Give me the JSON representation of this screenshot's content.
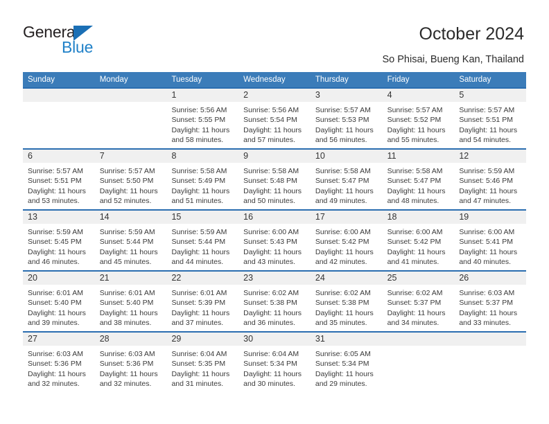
{
  "brand": {
    "name_part1": "General",
    "name_part2": "Blue",
    "triangle_color": "#1a6fb5",
    "blue_color": "#2081c8",
    "dark_color": "#231f20"
  },
  "header": {
    "title": "October 2024",
    "subtitle": "So Phisai, Bueng Kan, Thailand"
  },
  "theme": {
    "header_bg": "#3b7cb9",
    "row_border": "#2a6db0",
    "day_strip_bg": "#f0f0f0",
    "text_color": "#3a3a3a"
  },
  "calendar": {
    "weekdays": [
      "Sunday",
      "Monday",
      "Tuesday",
      "Wednesday",
      "Thursday",
      "Friday",
      "Saturday"
    ],
    "weeks": [
      [
        {
          "day": "",
          "lines": [],
          "empty": true
        },
        {
          "day": "",
          "lines": [],
          "empty": true
        },
        {
          "day": "1",
          "lines": [
            "Sunrise: 5:56 AM",
            "Sunset: 5:55 PM",
            "Daylight: 11 hours",
            "and 58 minutes."
          ]
        },
        {
          "day": "2",
          "lines": [
            "Sunrise: 5:56 AM",
            "Sunset: 5:54 PM",
            "Daylight: 11 hours",
            "and 57 minutes."
          ]
        },
        {
          "day": "3",
          "lines": [
            "Sunrise: 5:57 AM",
            "Sunset: 5:53 PM",
            "Daylight: 11 hours",
            "and 56 minutes."
          ]
        },
        {
          "day": "4",
          "lines": [
            "Sunrise: 5:57 AM",
            "Sunset: 5:52 PM",
            "Daylight: 11 hours",
            "and 55 minutes."
          ]
        },
        {
          "day": "5",
          "lines": [
            "Sunrise: 5:57 AM",
            "Sunset: 5:51 PM",
            "Daylight: 11 hours",
            "and 54 minutes."
          ]
        }
      ],
      [
        {
          "day": "6",
          "lines": [
            "Sunrise: 5:57 AM",
            "Sunset: 5:51 PM",
            "Daylight: 11 hours",
            "and 53 minutes."
          ]
        },
        {
          "day": "7",
          "lines": [
            "Sunrise: 5:57 AM",
            "Sunset: 5:50 PM",
            "Daylight: 11 hours",
            "and 52 minutes."
          ]
        },
        {
          "day": "8",
          "lines": [
            "Sunrise: 5:58 AM",
            "Sunset: 5:49 PM",
            "Daylight: 11 hours",
            "and 51 minutes."
          ]
        },
        {
          "day": "9",
          "lines": [
            "Sunrise: 5:58 AM",
            "Sunset: 5:48 PM",
            "Daylight: 11 hours",
            "and 50 minutes."
          ]
        },
        {
          "day": "10",
          "lines": [
            "Sunrise: 5:58 AM",
            "Sunset: 5:47 PM",
            "Daylight: 11 hours",
            "and 49 minutes."
          ]
        },
        {
          "day": "11",
          "lines": [
            "Sunrise: 5:58 AM",
            "Sunset: 5:47 PM",
            "Daylight: 11 hours",
            "and 48 minutes."
          ]
        },
        {
          "day": "12",
          "lines": [
            "Sunrise: 5:59 AM",
            "Sunset: 5:46 PM",
            "Daylight: 11 hours",
            "and 47 minutes."
          ]
        }
      ],
      [
        {
          "day": "13",
          "lines": [
            "Sunrise: 5:59 AM",
            "Sunset: 5:45 PM",
            "Daylight: 11 hours",
            "and 46 minutes."
          ]
        },
        {
          "day": "14",
          "lines": [
            "Sunrise: 5:59 AM",
            "Sunset: 5:44 PM",
            "Daylight: 11 hours",
            "and 45 minutes."
          ]
        },
        {
          "day": "15",
          "lines": [
            "Sunrise: 5:59 AM",
            "Sunset: 5:44 PM",
            "Daylight: 11 hours",
            "and 44 minutes."
          ]
        },
        {
          "day": "16",
          "lines": [
            "Sunrise: 6:00 AM",
            "Sunset: 5:43 PM",
            "Daylight: 11 hours",
            "and 43 minutes."
          ]
        },
        {
          "day": "17",
          "lines": [
            "Sunrise: 6:00 AM",
            "Sunset: 5:42 PM",
            "Daylight: 11 hours",
            "and 42 minutes."
          ]
        },
        {
          "day": "18",
          "lines": [
            "Sunrise: 6:00 AM",
            "Sunset: 5:42 PM",
            "Daylight: 11 hours",
            "and 41 minutes."
          ]
        },
        {
          "day": "19",
          "lines": [
            "Sunrise: 6:00 AM",
            "Sunset: 5:41 PM",
            "Daylight: 11 hours",
            "and 40 minutes."
          ]
        }
      ],
      [
        {
          "day": "20",
          "lines": [
            "Sunrise: 6:01 AM",
            "Sunset: 5:40 PM",
            "Daylight: 11 hours",
            "and 39 minutes."
          ]
        },
        {
          "day": "21",
          "lines": [
            "Sunrise: 6:01 AM",
            "Sunset: 5:40 PM",
            "Daylight: 11 hours",
            "and 38 minutes."
          ]
        },
        {
          "day": "22",
          "lines": [
            "Sunrise: 6:01 AM",
            "Sunset: 5:39 PM",
            "Daylight: 11 hours",
            "and 37 minutes."
          ]
        },
        {
          "day": "23",
          "lines": [
            "Sunrise: 6:02 AM",
            "Sunset: 5:38 PM",
            "Daylight: 11 hours",
            "and 36 minutes."
          ]
        },
        {
          "day": "24",
          "lines": [
            "Sunrise: 6:02 AM",
            "Sunset: 5:38 PM",
            "Daylight: 11 hours",
            "and 35 minutes."
          ]
        },
        {
          "day": "25",
          "lines": [
            "Sunrise: 6:02 AM",
            "Sunset: 5:37 PM",
            "Daylight: 11 hours",
            "and 34 minutes."
          ]
        },
        {
          "day": "26",
          "lines": [
            "Sunrise: 6:03 AM",
            "Sunset: 5:37 PM",
            "Daylight: 11 hours",
            "and 33 minutes."
          ]
        }
      ],
      [
        {
          "day": "27",
          "lines": [
            "Sunrise: 6:03 AM",
            "Sunset: 5:36 PM",
            "Daylight: 11 hours",
            "and 32 minutes."
          ]
        },
        {
          "day": "28",
          "lines": [
            "Sunrise: 6:03 AM",
            "Sunset: 5:36 PM",
            "Daylight: 11 hours",
            "and 32 minutes."
          ]
        },
        {
          "day": "29",
          "lines": [
            "Sunrise: 6:04 AM",
            "Sunset: 5:35 PM",
            "Daylight: 11 hours",
            "and 31 minutes."
          ]
        },
        {
          "day": "30",
          "lines": [
            "Sunrise: 6:04 AM",
            "Sunset: 5:34 PM",
            "Daylight: 11 hours",
            "and 30 minutes."
          ]
        },
        {
          "day": "31",
          "lines": [
            "Sunrise: 6:05 AM",
            "Sunset: 5:34 PM",
            "Daylight: 11 hours",
            "and 29 minutes."
          ]
        },
        {
          "day": "",
          "lines": [],
          "empty": true
        },
        {
          "day": "",
          "lines": [],
          "empty": true
        }
      ]
    ]
  }
}
